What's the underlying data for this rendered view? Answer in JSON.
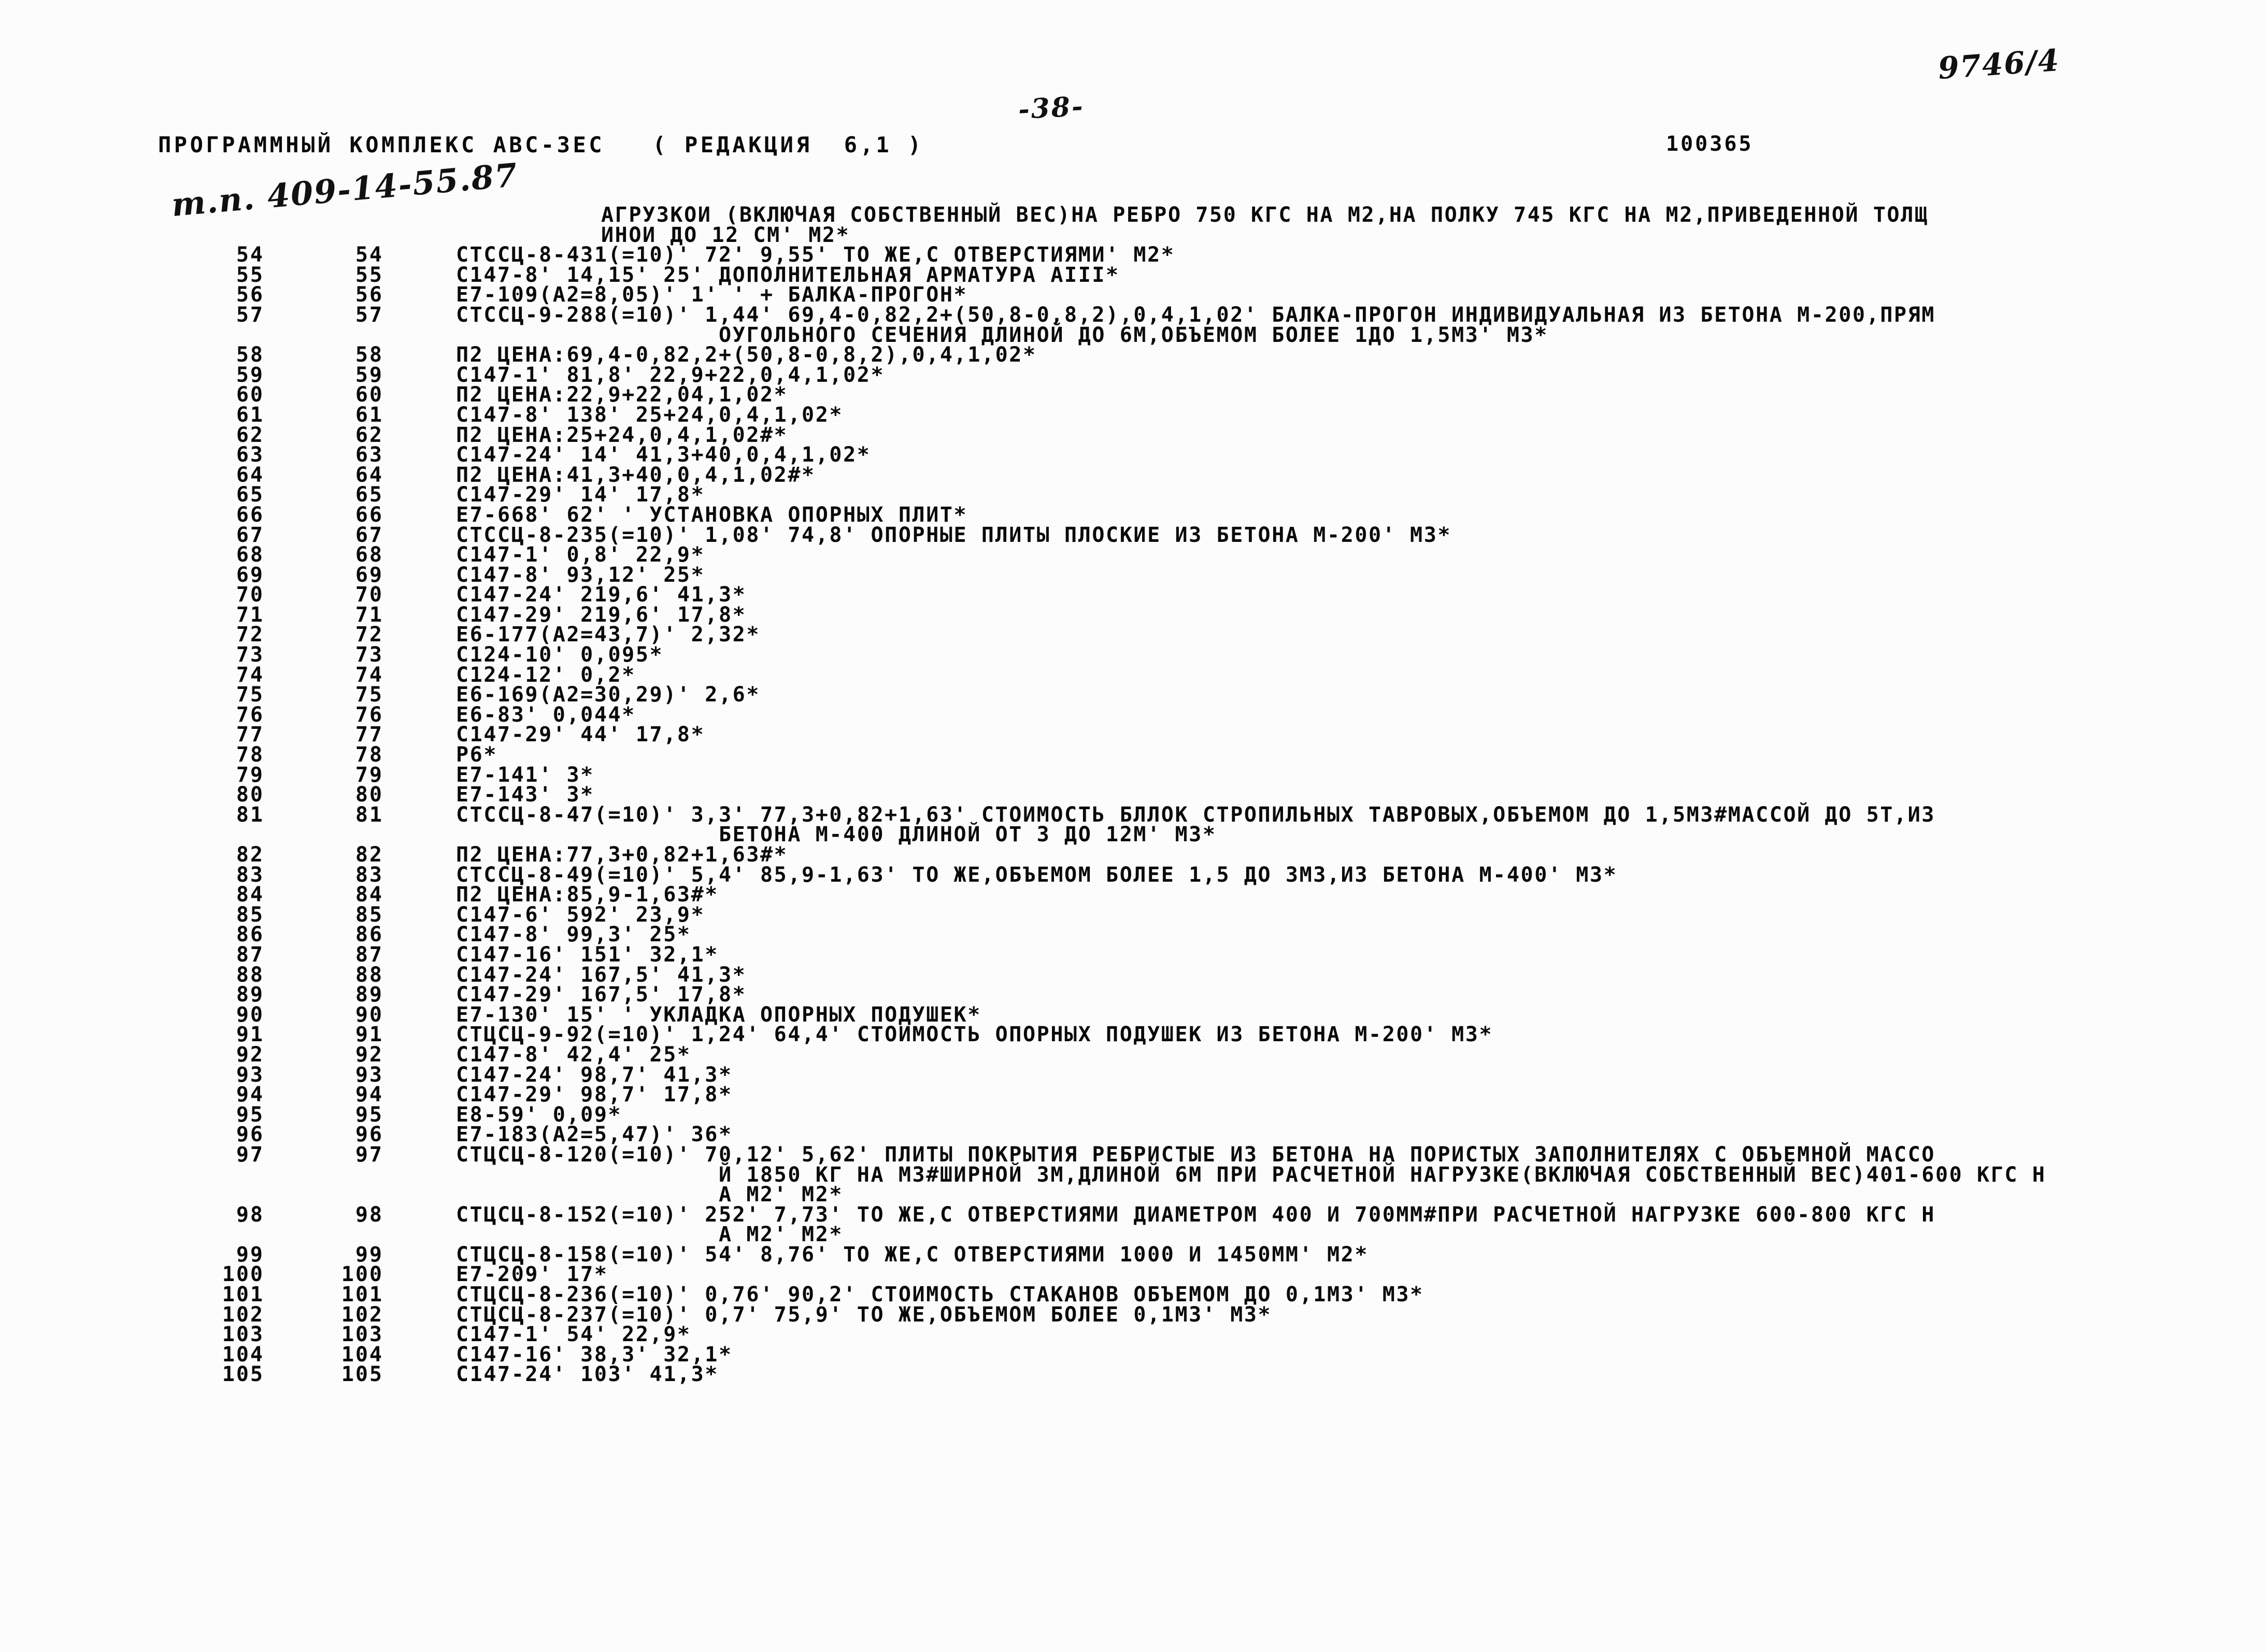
{
  "header": {
    "hand_top_right": "9746/4",
    "page_number": "-38-",
    "program_title": "ПРОГРАММНЫЙ КОМПЛЕКС АВС-ЗЕС   ( РЕДАКЦИЯ  6,1 )",
    "doc_code": "100365",
    "hand_project": "т.п. 409-14-55.87"
  },
  "listing": {
    "intro_lines": [
      "АГРУЗКОИ (ВКЛЮЧАЯ СОБСТВЕННЫЙ ВЕС)НА РЕБРО 750 КГС НА М2,НА ПОЛКУ 745 КГС НА М2,ПРИВЕДЕННОЙ ТОЛЩ",
      "ИНОИ ДО 12 СМ' М2*"
    ],
    "rows": [
      {
        "a": "54",
        "b": "54",
        "text": "СТССЦ-8-431(=10)' 72' 9,55' ТО ЖЕ,С ОТВЕРСТИЯМИ' М2*"
      },
      {
        "a": "55",
        "b": "55",
        "text": "С147-8' 14,15' 25' ДОПОЛНИТЕЛЬНАЯ АРМАТУРА АIII*"
      },
      {
        "a": "56",
        "b": "56",
        "text": "Е7-109(А2=8,05)' 1' ' + БАЛКА-ПРОГОН*"
      },
      {
        "a": "57",
        "b": "57",
        "text": "СТССЦ-9-288(=10)' 1,44' 69,4-0,82,2+(50,8-0,8,2),0,4,1,02' БАЛКА-ПРОГОН ИНДИВИДУАЛЬНАЯ ИЗ БЕТОНА М-200,ПРЯМ"
      },
      {
        "a": "",
        "b": "",
        "cont": true,
        "text": "                   ОУГОЛЬНОГО СЕЧЕНИЯ ДЛИНОЙ ДО 6М,ОБЪЕМОМ БОЛЕЕ 1ДО 1,5М3' М3*"
      },
      {
        "a": "58",
        "b": "58",
        "text": "П2 ЦЕНА:69,4-0,82,2+(50,8-0,8,2),0,4,1,02*"
      },
      {
        "a": "59",
        "b": "59",
        "text": "С147-1' 81,8' 22,9+22,0,4,1,02*"
      },
      {
        "a": "60",
        "b": "60",
        "text": "П2 ЦЕНА:22,9+22,04,1,02*"
      },
      {
        "a": "61",
        "b": "61",
        "text": "С147-8' 138' 25+24,0,4,1,02*"
      },
      {
        "a": "62",
        "b": "62",
        "text": "П2 ЦЕНА:25+24,0,4,1,02#*"
      },
      {
        "a": "63",
        "b": "63",
        "text": "С147-24' 14' 41,3+40,0,4,1,02*"
      },
      {
        "a": "64",
        "b": "64",
        "text": "П2 ЦЕНА:41,3+40,0,4,1,02#*"
      },
      {
        "a": "65",
        "b": "65",
        "text": "С147-29' 14' 17,8*"
      },
      {
        "a": "66",
        "b": "66",
        "text": "Е7-668' 62' ' УСТАНОВКА ОПОРНЫХ ПЛИТ*"
      },
      {
        "a": "67",
        "b": "67",
        "text": "СТССЦ-8-235(=10)' 1,08' 74,8' ОПОРНЫЕ ПЛИТЫ ПЛОСКИЕ ИЗ БЕТОНА М-200' М3*"
      },
      {
        "a": "68",
        "b": "68",
        "text": "С147-1' 0,8' 22,9*"
      },
      {
        "a": "69",
        "b": "69",
        "text": "С147-8' 93,12' 25*"
      },
      {
        "a": "70",
        "b": "70",
        "text": "С147-24' 219,6' 41,3*"
      },
      {
        "a": "71",
        "b": "71",
        "text": "С147-29' 219,6' 17,8*"
      },
      {
        "a": "72",
        "b": "72",
        "text": "Е6-177(А2=43,7)' 2,32*"
      },
      {
        "a": "73",
        "b": "73",
        "text": "С124-10' 0,095*"
      },
      {
        "a": "74",
        "b": "74",
        "text": "С124-12' 0,2*"
      },
      {
        "a": "75",
        "b": "75",
        "text": "Е6-169(А2=30,29)' 2,6*"
      },
      {
        "a": "76",
        "b": "76",
        "text": "Е6-83' 0,044*"
      },
      {
        "a": "77",
        "b": "77",
        "text": "С147-29' 44' 17,8*"
      },
      {
        "a": "78",
        "b": "78",
        "text": "Р6*"
      },
      {
        "a": "79",
        "b": "79",
        "text": "Е7-141' 3*"
      },
      {
        "a": "80",
        "b": "80",
        "text": "Е7-143' 3*"
      },
      {
        "a": "81",
        "b": "81",
        "text": "СТССЦ-8-47(=10)' 3,3' 77,3+0,82+1,63' СТОИМОСТЬ БЛЛОК СТРОПИЛЬНЫХ ТАВРОВЫХ,ОБЪЕМОМ ДО 1,5М3#МАССОЙ ДО 5Т,ИЗ"
      },
      {
        "a": "",
        "b": "",
        "cont": true,
        "text": "                   БЕТОНА М-400 ДЛИНОЙ ОТ 3 ДО 12М' М3*"
      },
      {
        "a": "82",
        "b": "82",
        "text": "П2 ЦЕНА:77,3+0,82+1,63#*"
      },
      {
        "a": "83",
        "b": "83",
        "text": "СТССЦ-8-49(=10)' 5,4' 85,9-1,63' ТО ЖЕ,ОБЪЕМОМ БОЛЕЕ 1,5 ДО 3М3,ИЗ БЕТОНА М-400' М3*"
      },
      {
        "a": "84",
        "b": "84",
        "text": "П2 ЦЕНА:85,9-1,63#*"
      },
      {
        "a": "85",
        "b": "85",
        "text": "С147-6' 592' 23,9*"
      },
      {
        "a": "86",
        "b": "86",
        "text": "С147-8' 99,3' 25*"
      },
      {
        "a": "87",
        "b": "87",
        "text": "С147-16' 151' 32,1*"
      },
      {
        "a": "88",
        "b": "88",
        "text": "С147-24' 167,5' 41,3*"
      },
      {
        "a": "89",
        "b": "89",
        "text": "С147-29' 167,5' 17,8*"
      },
      {
        "a": "90",
        "b": "90",
        "text": "Е7-130' 15' ' УКЛАДКА ОПОРНЫХ ПОДУШЕК*"
      },
      {
        "a": "91",
        "b": "91",
        "text": "СТЦСЦ-9-92(=10)' 1,24' 64,4' СТОИМОСТЬ ОПОРНЫХ ПОДУШЕК ИЗ БЕТОНА М-200' М3*"
      },
      {
        "a": "92",
        "b": "92",
        "text": "С147-8' 42,4' 25*"
      },
      {
        "a": "93",
        "b": "93",
        "text": "С147-24' 98,7' 41,3*"
      },
      {
        "a": "94",
        "b": "94",
        "text": "С147-29' 98,7' 17,8*"
      },
      {
        "a": "95",
        "b": "95",
        "text": "Е8-59' 0,09*"
      },
      {
        "a": "96",
        "b": "96",
        "text": "Е7-183(А2=5,47)' 36*"
      },
      {
        "a": "97",
        "b": "97",
        "text": "СТЦСЦ-8-120(=10)' 70,12' 5,62' ПЛИТЫ ПОКРЫТИЯ РЕБРИСТЫЕ ИЗ БЕТОНА НА ПОРИСТЫХ ЗАПОЛНИТЕЛЯХ С ОБЪЕМНОЙ МАССО"
      },
      {
        "a": "",
        "b": "",
        "cont": true,
        "text": "                   Й 1850 КГ НА М3#ШИРНОЙ 3М,ДЛИНОЙ 6М ПРИ РАСЧЕТНОЙ НАГРУЗКЕ(ВКЛЮЧАЯ СОБСТВЕННЫЙ ВЕС)401-600 КГС Н"
      },
      {
        "a": "",
        "b": "",
        "cont": true,
        "text": "                   А М2' М2*"
      },
      {
        "a": "98",
        "b": "98",
        "text": "СТЦСЦ-8-152(=10)' 252' 7,73' ТО ЖЕ,С ОТВЕРСТИЯМИ ДИАМЕТРОМ 400 И 700ММ#ПРИ РАСЧЕТНОЙ НАГРУЗКЕ 600-800 КГС Н"
      },
      {
        "a": "",
        "b": "",
        "cont": true,
        "text": "                   А М2' М2*"
      },
      {
        "a": "99",
        "b": "99",
        "text": "СТЦСЦ-8-158(=10)' 54' 8,76' ТО ЖЕ,С ОТВЕРСТИЯМИ 1000 И 1450ММ' М2*"
      },
      {
        "a": "100",
        "b": "100",
        "text": "Е7-209' 17*"
      },
      {
        "a": "101",
        "b": "101",
        "text": "СТЦСЦ-8-236(=10)' 0,76' 90,2' СТОИМОСТЬ СТАКАНОВ ОБЪЕМОМ ДО 0,1М3' М3*"
      },
      {
        "a": "102",
        "b": "102",
        "text": "СТЦСЦ-8-237(=10)' 0,7' 75,9' ТО ЖЕ,ОБЪЕМОМ БОЛЕЕ 0,1М3' М3*"
      },
      {
        "a": "103",
        "b": "103",
        "text": "С147-1' 54' 22,9*"
      },
      {
        "a": "104",
        "b": "104",
        "text": "С147-16' 38,3' 32,1*"
      },
      {
        "a": "105",
        "b": "105",
        "text": "С147-24' 103' 41,3*"
      }
    ]
  }
}
